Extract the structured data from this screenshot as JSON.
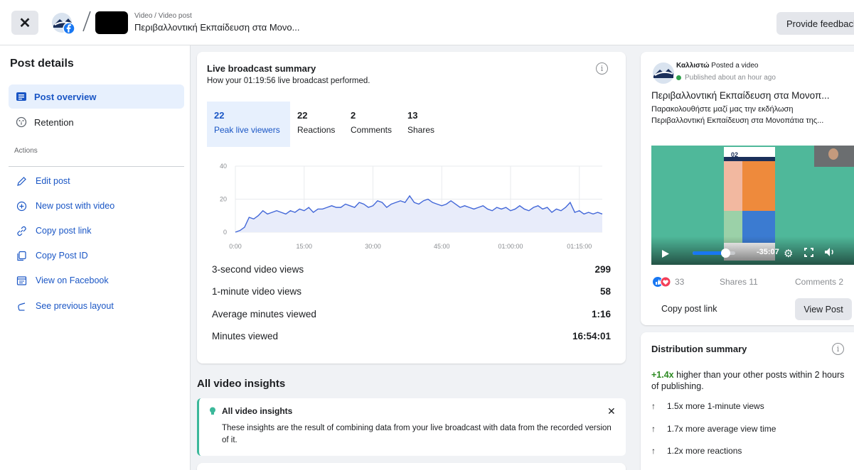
{
  "header": {
    "close_label": "✕",
    "breadcrumb_small": "Video / Video post",
    "breadcrumb_title": "Περιβαλλοντική Εκπαίδευση στα Μονο...",
    "feedback_label": "Provide feedback"
  },
  "sidebar": {
    "title": "Post details",
    "nav": [
      {
        "label": "Post overview",
        "icon": "post-overview-icon",
        "active": true
      },
      {
        "label": "Retention",
        "icon": "retention-icon",
        "active": false
      }
    ],
    "actions_label": "Actions",
    "actions": [
      {
        "label": "Edit post",
        "icon": "pencil-icon"
      },
      {
        "label": "New post with video",
        "icon": "plus-circle-icon"
      },
      {
        "label": "Copy post link",
        "icon": "link-icon"
      },
      {
        "label": "Copy Post ID",
        "icon": "copy-icon"
      },
      {
        "label": "View on Facebook",
        "icon": "window-icon"
      },
      {
        "label": "See previous layout",
        "icon": "undo-icon"
      }
    ]
  },
  "summary": {
    "title": "Live broadcast summary",
    "subtitle": "How your 01:19:56 live broadcast performed.",
    "tabs": [
      {
        "value": "22",
        "label": "Peak live viewers",
        "active": true
      },
      {
        "value": "22",
        "label": "Reactions",
        "active": false
      },
      {
        "value": "2",
        "label": "Comments",
        "active": false
      },
      {
        "value": "13",
        "label": "Shares",
        "active": false
      }
    ],
    "stats": [
      {
        "label": "3-second video views",
        "value": "299"
      },
      {
        "label": "1-minute video views",
        "value": "58"
      },
      {
        "label": "Average minutes viewed",
        "value": "1:16"
      },
      {
        "label": "Minutes viewed",
        "value": "16:54:01"
      }
    ]
  },
  "chart_data": {
    "type": "area",
    "title": "",
    "xlabel": "",
    "ylabel": "",
    "x_ticks": [
      "0:00",
      "15:00",
      "30:00",
      "45:00",
      "01:00:00",
      "01:15:00"
    ],
    "y_ticks": [
      0,
      20,
      40
    ],
    "ylim": [
      0,
      40
    ],
    "xlim": [
      0,
      80
    ],
    "grid": true,
    "series": [
      {
        "x": [
          0,
          1,
          2,
          3,
          4,
          5,
          6,
          7,
          8,
          9,
          10,
          11,
          12,
          13,
          14,
          15,
          16,
          17,
          18,
          19,
          20,
          21,
          22,
          23,
          24,
          25,
          26,
          27,
          28,
          29,
          30,
          31,
          32,
          33,
          34,
          35,
          36,
          37,
          38,
          39,
          40,
          41,
          42,
          43,
          44,
          45,
          46,
          47,
          48,
          49,
          50,
          51,
          52,
          53,
          54,
          55,
          56,
          57,
          58,
          59,
          60,
          61,
          62,
          63,
          64,
          65,
          66,
          67,
          68,
          69,
          70,
          71,
          72,
          73,
          74,
          75,
          76,
          77,
          78,
          79,
          80
        ],
        "values": [
          0,
          1,
          3,
          9,
          8,
          10,
          13,
          11,
          12,
          13,
          12,
          11,
          13,
          12,
          14,
          13,
          15,
          12,
          14,
          14,
          15,
          16,
          15,
          15,
          17,
          16,
          15,
          18,
          17,
          15,
          16,
          19,
          18,
          15,
          17,
          18,
          19,
          18,
          22,
          18,
          17,
          19,
          20,
          18,
          17,
          16,
          17,
          19,
          17,
          15,
          16,
          15,
          14,
          15,
          16,
          14,
          13,
          15,
          14,
          15,
          13,
          14,
          16,
          14,
          13,
          15,
          16,
          14,
          15,
          12,
          14,
          13,
          15,
          18,
          12,
          13,
          11,
          12,
          11,
          12,
          11
        ]
      }
    ],
    "colors": {
      "line": "#4267d8",
      "fill": "#e8ecfa"
    }
  },
  "insights": {
    "heading": "All video insights",
    "notice_title": "All video insights",
    "notice_body": "These insights are the result of combining data from your live broadcast with data from the recorded version of it.",
    "close_label": "✕"
  },
  "post": {
    "author": "Καλλιστώ",
    "action": "Posted a video",
    "published": "Published about an hour ago",
    "title": "Περιβαλλοντική Εκπαίδευση στα Μονοπ...",
    "desc_line1": "Παρακολουθήστε μαζί μας την εκδήλωση",
    "desc_line2": "Περιβαλλοντική Εκπαίδευση στα Μονοπάτια της...",
    "slide_badge": "02",
    "video_time": "-35:07",
    "reaction_count": "33",
    "shares": "Shares 11",
    "comments": "Comments 2",
    "copy_link": "Copy post link",
    "view_post": "View Post"
  },
  "distribution": {
    "title": "Distribution summary",
    "highlight": "+1.4x",
    "summary_rest": "higher than your other posts within 2 hours of publishing.",
    "items": [
      "1.5x more 1-minute views",
      "1.7x more average view time",
      "1.2x more reactions"
    ]
  },
  "colors": {
    "accent": "#1a56c5",
    "active_bg": "#e7f0fd",
    "positive": "#2d8a22",
    "notice_border": "#3cb89a"
  }
}
